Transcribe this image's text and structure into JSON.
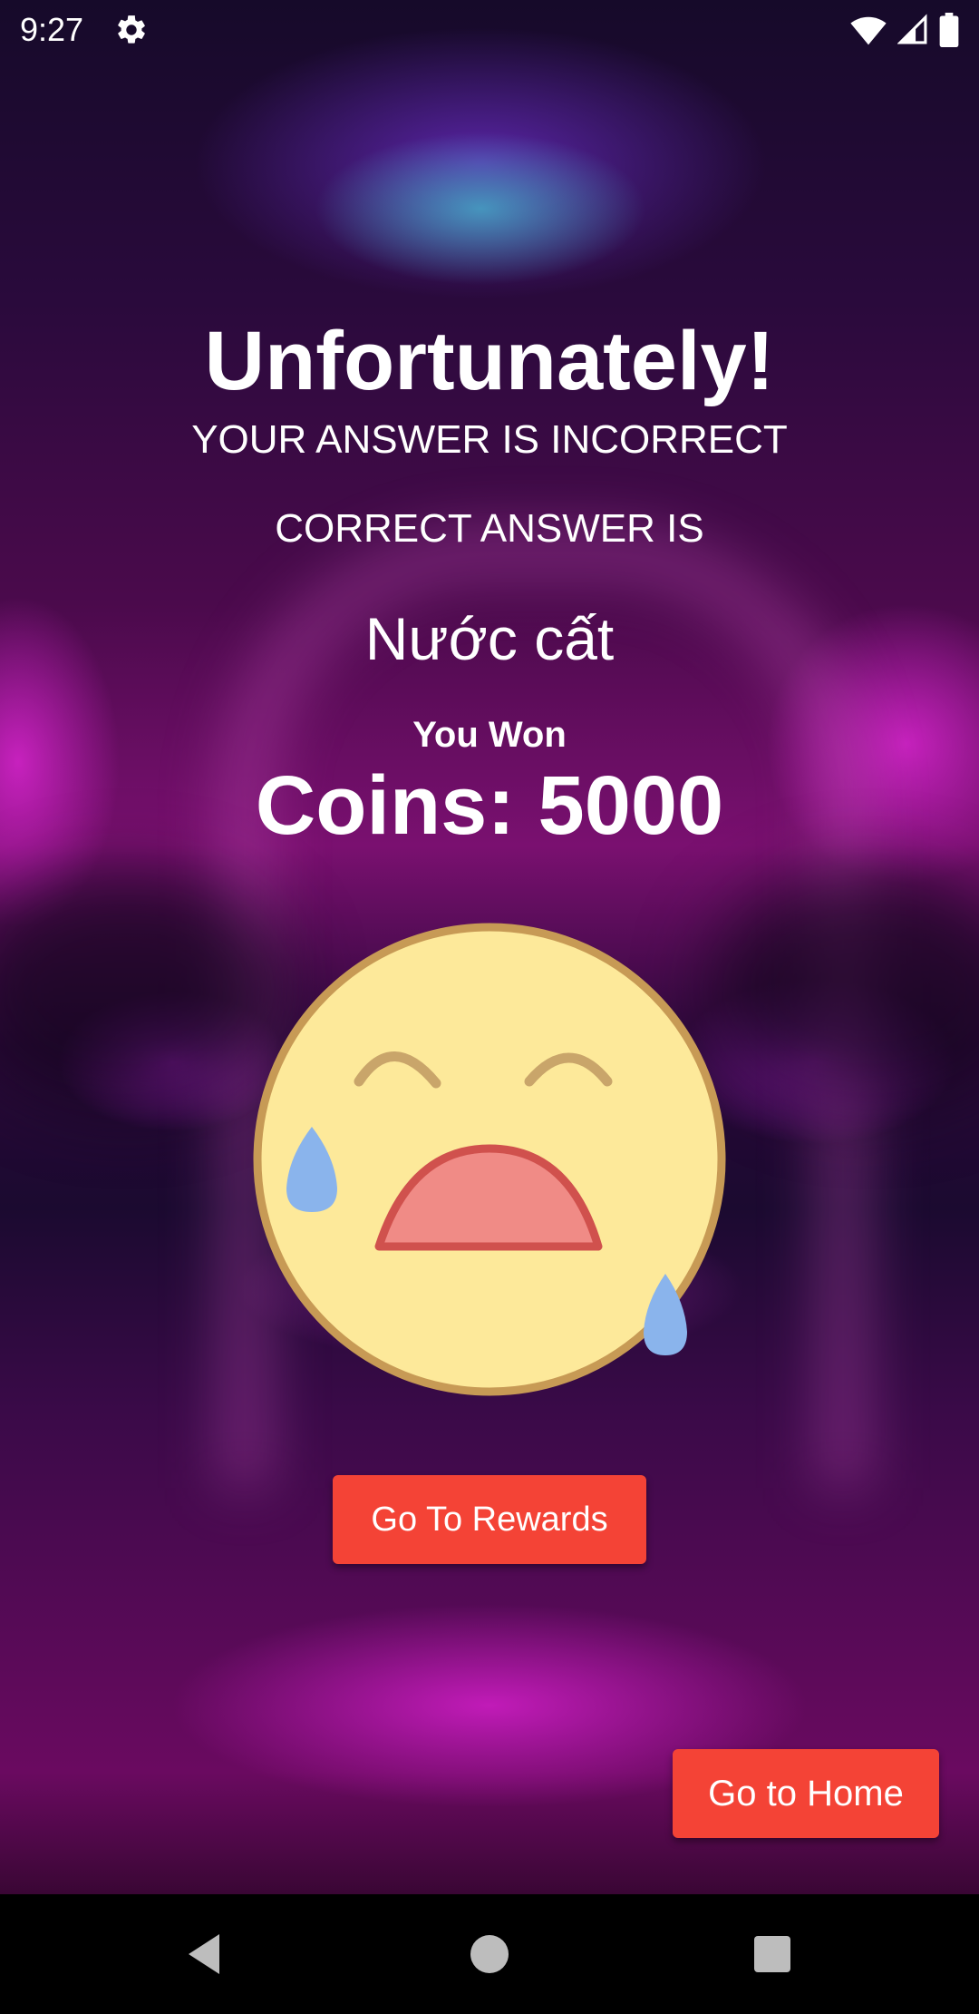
{
  "status_bar": {
    "time": "9:27",
    "icons": [
      "gear-icon",
      "wifi-icon",
      "cell-signal-icon",
      "battery-icon"
    ]
  },
  "result": {
    "title": "Unfortunately!",
    "subtitle": "YOUR ANSWER IS INCORRECT",
    "correct_label": "CORRECT ANSWER IS",
    "correct_answer": "Nước cất",
    "you_won_label": "You Won",
    "coins_text": "Coins: 5000"
  },
  "emoji": {
    "name": "crying-face-icon",
    "face_color": "#fde99a",
    "outline_color": "#c79a55",
    "tear_color": "#8ab4ec",
    "mouth_color": "#f08b86"
  },
  "buttons": {
    "rewards_label": "Go To Rewards",
    "home_label": "Go to Home",
    "color": "#f44336"
  },
  "nav_bar": {
    "items": [
      "back-icon",
      "home-circle-icon",
      "recents-square-icon"
    ]
  }
}
